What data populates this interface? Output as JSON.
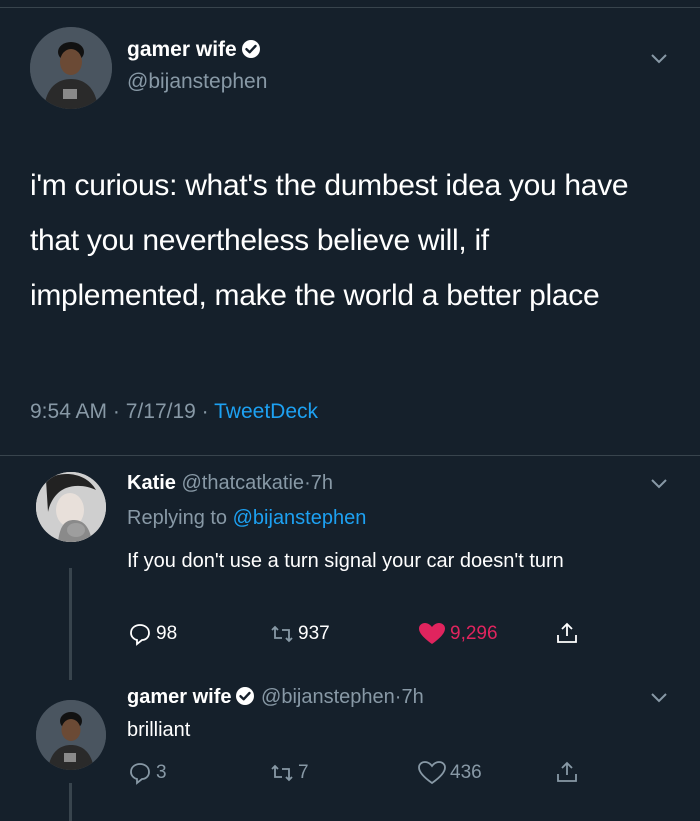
{
  "colors": {
    "background": "#15202b",
    "muted": "#8899a6",
    "link": "#1da1f2",
    "like": "#e0245e",
    "divider": "#38444d"
  },
  "main_tweet": {
    "display_name": "gamer wife",
    "handle": "@bijanstephen",
    "verified": true,
    "text": "i'm curious: what's the dumbest idea you have that you nevertheless believe will, if implemented, make the world a better place",
    "time": "9:54 AM",
    "date": "7/17/19",
    "source": "TweetDeck",
    "separator": "·"
  },
  "replies": [
    {
      "display_name": "Katie",
      "handle": "@thatcatkatie",
      "age": "7h",
      "replying_label": "Replying to",
      "replying_to": "@bijanstephen",
      "text": "If you don't use a turn signal your car doesn't turn",
      "reply_count": "98",
      "retweet_count": "937",
      "like_count": "9,296",
      "liked": true
    },
    {
      "display_name": "gamer wife",
      "handle": "@bijanstephen",
      "age": "7h",
      "verified": true,
      "text": "brilliant",
      "reply_count": "3",
      "retweet_count": "7",
      "like_count": "436",
      "liked": false
    }
  ],
  "icons": {
    "menu": "chevron-down-icon",
    "reply": "reply-icon",
    "retweet": "retweet-icon",
    "like": "heart-icon",
    "share": "share-icon",
    "verified": "verified-badge-icon"
  }
}
